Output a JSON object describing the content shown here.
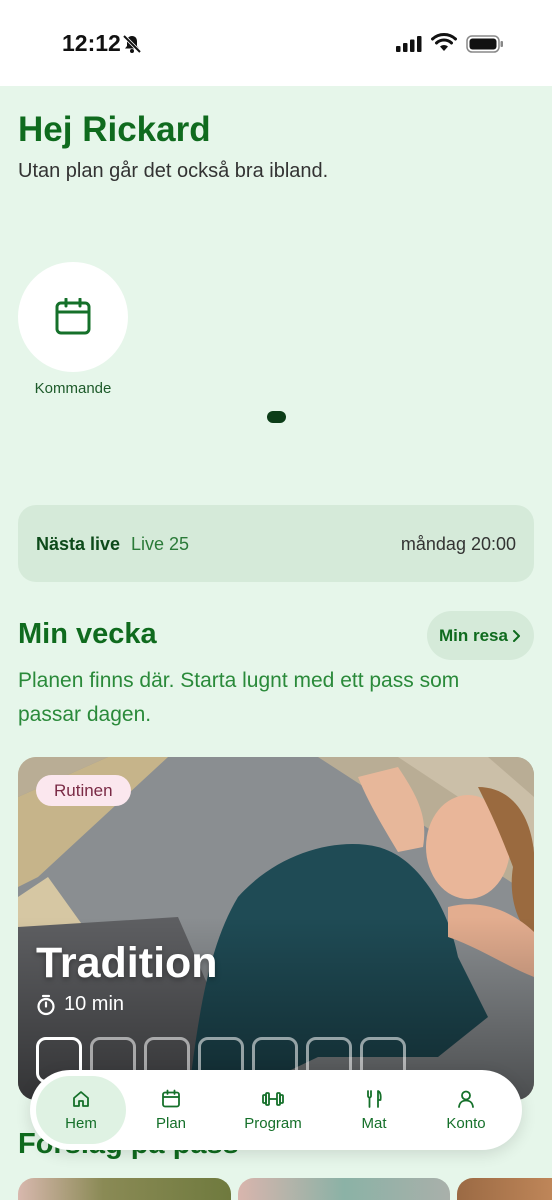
{
  "status_bar": {
    "time": "12:12"
  },
  "header": {
    "greeting": "Hej Rickard",
    "subtitle": "Utan plan går det också bra ibland."
  },
  "shortcuts": [
    {
      "label": "Kommande",
      "icon": "calendar-icon"
    }
  ],
  "live": {
    "label": "Nästa live",
    "name": "Live 25",
    "time": "måndag 20:00"
  },
  "week": {
    "title": "Min vecka",
    "journey_button": "Min resa",
    "subtitle": "Planen finns där. Starta lugnt med ett pass som passar dagen."
  },
  "workout": {
    "tag": "Rutinen",
    "title": "Tradition",
    "duration": "10 min",
    "days_total": 7,
    "active_day_index": 0
  },
  "suggestions": {
    "title": "Förslag på pass"
  },
  "nav": {
    "items": [
      {
        "label": "Hem",
        "icon": "home-icon",
        "active": true
      },
      {
        "label": "Plan",
        "icon": "calendar-icon",
        "active": false
      },
      {
        "label": "Program",
        "icon": "dumbbell-icon",
        "active": false
      },
      {
        "label": "Mat",
        "icon": "fork-knife-icon",
        "active": false
      },
      {
        "label": "Konto",
        "icon": "person-icon",
        "active": false
      }
    ]
  },
  "colors": {
    "background": "#e6f6ea",
    "primary_green": "#0f6b1e",
    "card_green": "#d5ead9",
    "tag_pink": "#fbe7ee"
  }
}
